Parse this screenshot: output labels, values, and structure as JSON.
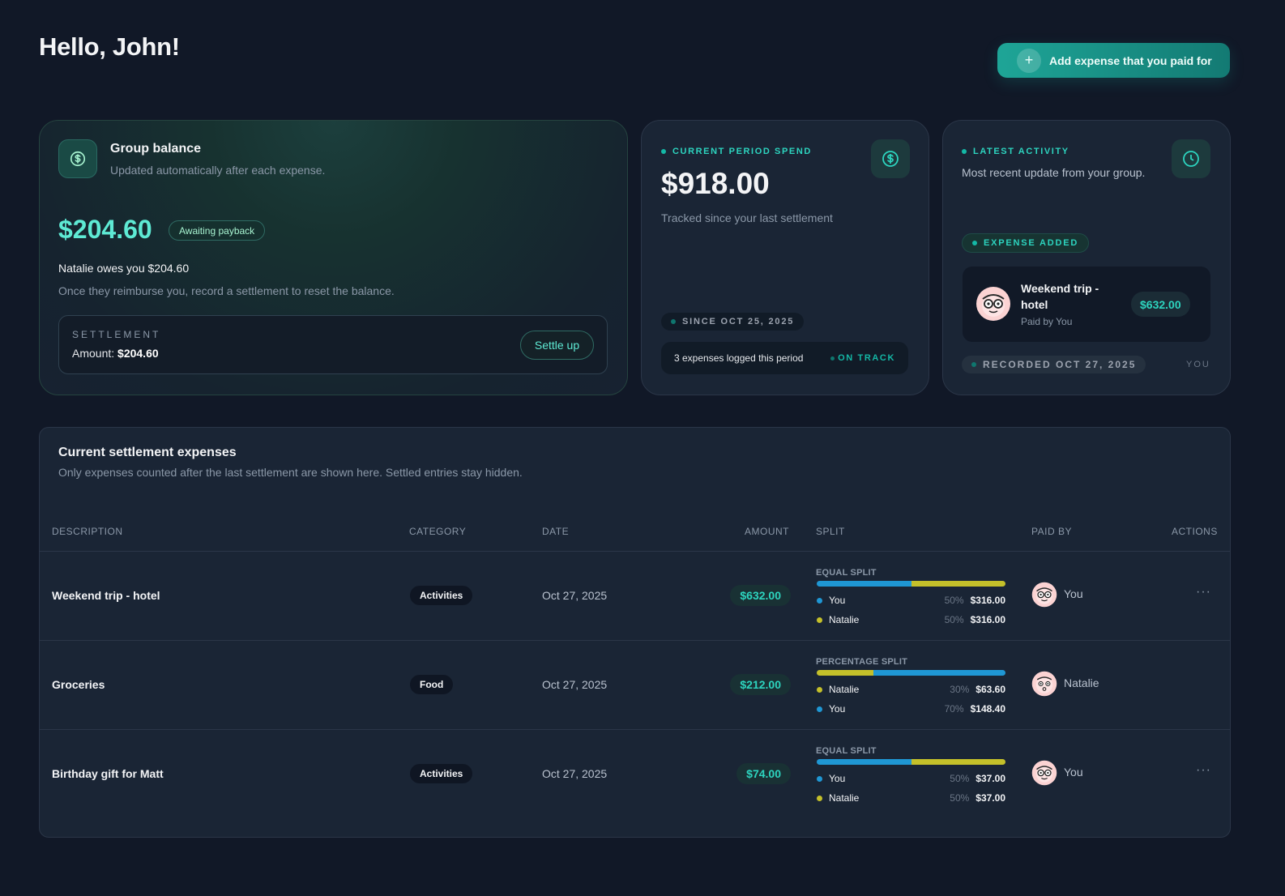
{
  "header": {
    "greeting": "Hello, John!",
    "add_button_label": "Add expense that you paid for"
  },
  "balance_card": {
    "title": "Group balance",
    "subtitle": "Updated automatically after each expense.",
    "amount": "$204.60",
    "status_badge": "Awaiting payback",
    "owes_text": "Natalie owes you $204.60",
    "hint": "Once they reimburse you, record a settlement to reset the balance.",
    "settlement_label": "SETTLEMENT",
    "settlement_amount_prefix": "Amount:",
    "settlement_amount": "$204.60",
    "settle_button": "Settle up"
  },
  "spend_card": {
    "eyebrow": "CURRENT PERIOD SPEND",
    "amount": "$918.00",
    "subtitle": "Tracked since your last settlement",
    "since": "SINCE OCT 25, 2025",
    "logged_text": "3 expenses logged this period",
    "status": "ON TRACK"
  },
  "activity_card": {
    "eyebrow": "LATEST ACTIVITY",
    "subtitle": "Most recent update from your group.",
    "event_type": "EXPENSE ADDED",
    "expense_title": "Weekend trip - hotel",
    "paid_by": "Paid by You",
    "amount": "$632.00",
    "recorded": "RECORDED OCT 27, 2025",
    "actor": "YOU"
  },
  "expenses_table": {
    "title": "Current settlement expenses",
    "subtitle": "Only expenses counted after the last settlement are shown here. Settled entries stay hidden.",
    "columns": [
      "DESCRIPTION",
      "CATEGORY",
      "DATE",
      "AMOUNT",
      "SPLIT",
      "PAID BY",
      "ACTIONS"
    ],
    "rows": [
      {
        "description": "Weekend trip - hotel",
        "category": "Activities",
        "date": "Oct 27, 2025",
        "amount": "$632.00",
        "split_type": "EQUAL SPLIT",
        "split_bar": [
          0.5,
          0.5
        ],
        "splits": [
          {
            "name": "You",
            "percent": "50%",
            "value": "$316.00",
            "color": "#1f97d4"
          },
          {
            "name": "Natalie",
            "percent": "50%",
            "value": "$316.00",
            "color": "#c4c02a"
          }
        ],
        "paid_by": "You",
        "actions_icon": "···"
      },
      {
        "description": "Groceries",
        "category": "Food",
        "date": "Oct 27, 2025",
        "amount": "$212.00",
        "split_type": "PERCENTAGE SPLIT",
        "split_bar": [
          0.3,
          0.7
        ],
        "splits": [
          {
            "name": "Natalie",
            "percent": "30%",
            "value": "$63.60",
            "color": "#c4c02a"
          },
          {
            "name": "You",
            "percent": "70%",
            "value": "$148.40",
            "color": "#1f97d4"
          }
        ],
        "paid_by": "Natalie",
        "actions_icon": ""
      },
      {
        "description": "Birthday gift for Matt",
        "category": "Activities",
        "date": "Oct 27, 2025",
        "amount": "$74.00",
        "split_type": "EQUAL SPLIT",
        "split_bar": [
          0.5,
          0.5
        ],
        "splits": [
          {
            "name": "You",
            "percent": "50%",
            "value": "$37.00",
            "color": "#1f97d4"
          },
          {
            "name": "Natalie",
            "percent": "50%",
            "value": "$37.00",
            "color": "#c4c02a"
          }
        ],
        "paid_by": "You",
        "actions_icon": "···"
      }
    ]
  },
  "colors": {
    "accent": "#14b8a6",
    "you": "#1f97d4",
    "natalie": "#c4c02a",
    "background": "#111827"
  }
}
